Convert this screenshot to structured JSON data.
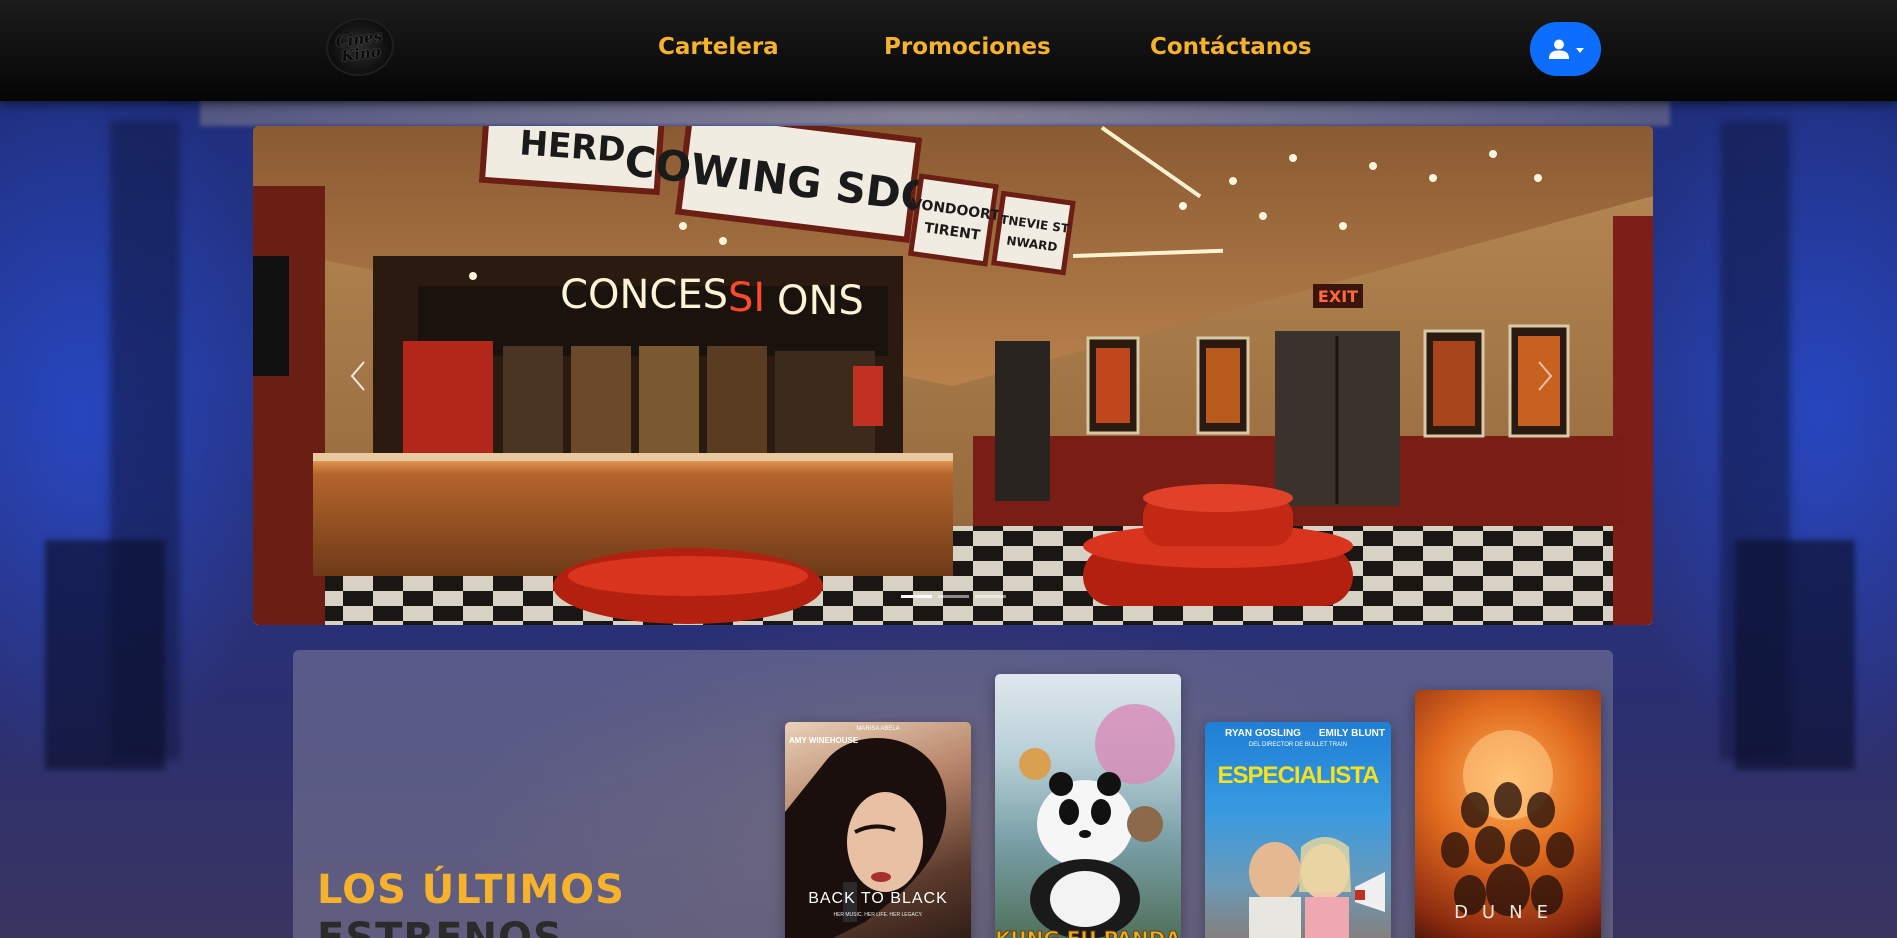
{
  "header": {
    "logo": {
      "line1": "Cines",
      "line2": "Kino"
    },
    "nav": [
      {
        "label": "Cartelera"
      },
      {
        "label": "Promociones"
      },
      {
        "label": "Contáctanos"
      }
    ],
    "user_button": {
      "icon": "user-icon",
      "color": "#0d6efd"
    }
  },
  "carousel": {
    "slide_count": 3,
    "active_slide": 1,
    "slide_text": {
      "sign_herd": "HERD",
      "sign_coming": "COWING SDON",
      "sign_small1_a": "VONDOORT",
      "sign_small1_b": "TIRENT",
      "sign_small2_a": "TNEVIE ST",
      "sign_small2_b": "NWARD",
      "concessions_a": "CONCES",
      "concessions_b": "SI",
      "concessions_c": "ONS",
      "exit": "EXIT"
    },
    "prev_icon": "chevron-left-icon",
    "next_icon": "chevron-right-icon"
  },
  "premieres": {
    "title_line1": "LOS ÚLTIMOS",
    "title_line2": "ESTRENOS",
    "posters": [
      {
        "title": "BACK TO BLACK",
        "top_small": "MARISA ABELA",
        "top": "AMY WINEHOUSE",
        "tagline": "HER MUSIC. HER LIFE. HER LEGACY."
      },
      {
        "title": "KUNG FU PANDA",
        "top_small": "",
        "top": "",
        "tagline": ""
      },
      {
        "title": "ESPECIALISTA",
        "top_small": "DEL DIRECTOR DE BULLET TRAIN",
        "top": "RYAN GOSLING",
        "top2": "EMILY BLUNT",
        "tagline": ""
      },
      {
        "title": "DUNE",
        "top_small": "",
        "top": "",
        "tagline": ""
      }
    ]
  },
  "colors": {
    "accent": "#f6b22c",
    "navbar": "#0a0a0a",
    "primary_button": "#0d6efd"
  }
}
